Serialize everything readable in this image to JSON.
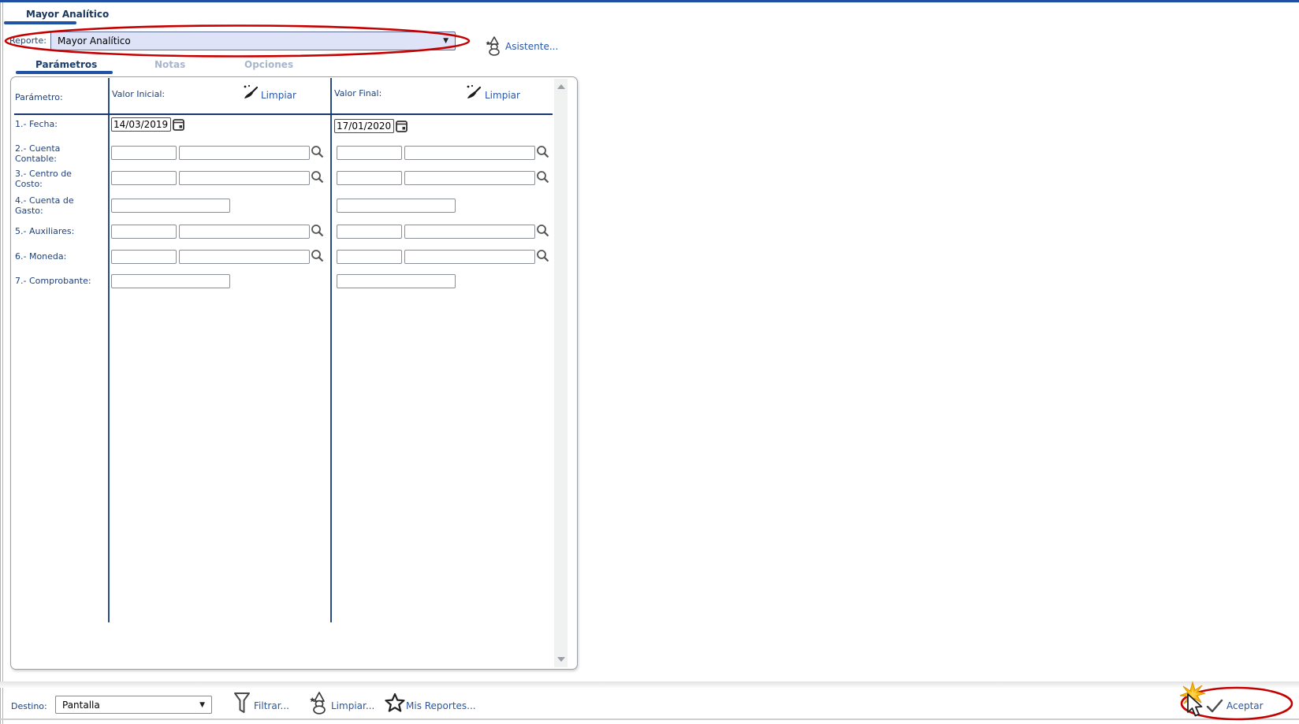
{
  "window": {
    "page_tab": "Mayor Analítico"
  },
  "report_bar": {
    "label": "Reporte:",
    "selected": "Mayor Analítico",
    "dropdown_caret": "▼",
    "assistant": "Asistente..."
  },
  "tabs": {
    "parameters": "Parámetros",
    "notes": "Notas",
    "options": "Opciones"
  },
  "grid": {
    "param_header": "Parámetro:",
    "initial_header": "Valor Inicial:",
    "final_header": "Valor Final:",
    "clear_initial": "Limpiar",
    "clear_final": "Limpiar",
    "rows": [
      {
        "label": "1.- Fecha:",
        "type": "date",
        "initial": "14/03/2019",
        "final": "17/01/2020"
      },
      {
        "label": "2.- Cuenta Contable:",
        "type": "lookup",
        "initial_code": "",
        "initial_desc": "",
        "final_code": "",
        "final_desc": ""
      },
      {
        "label": "3.- Centro de Costo:",
        "type": "lookup",
        "initial_code": "",
        "initial_desc": "",
        "final_code": "",
        "final_desc": ""
      },
      {
        "label": "4.- Cuenta de Gasto:",
        "type": "text",
        "initial": "",
        "final": ""
      },
      {
        "label": "5.- Auxiliares:",
        "type": "lookup",
        "initial_code": "",
        "initial_desc": "",
        "final_code": "",
        "final_desc": ""
      },
      {
        "label": "6.- Moneda:",
        "type": "lookup",
        "initial_code": "",
        "initial_desc": "",
        "final_code": "",
        "final_desc": ""
      },
      {
        "label": "7.- Comprobante:",
        "type": "text",
        "initial": "",
        "final": ""
      }
    ]
  },
  "footer": {
    "destination_label": "Destino:",
    "destination_selected": "Pantalla",
    "dropdown_caret": "▼",
    "filter": "Filtrar...",
    "clear": "Limpiar...",
    "my_reports": "Mis Reportes...",
    "accept": "Aceptar"
  },
  "icons": {
    "wizard": "wizard-icon",
    "broom": "broom-icon",
    "magnifier": "magnifier-icon",
    "calendar": "calendar-icon",
    "funnel": "funnel-icon",
    "star": "star-icon",
    "check": "check-icon",
    "caret": "caret-down-icon",
    "cursor": "mouse-cursor-icon",
    "click_burst": "click-starburst-icon",
    "annotation": "red-ellipse-annotation"
  },
  "colors": {
    "top_line": "#2050a4",
    "accent_underline": "#2153a4",
    "label_navy": "#1f4077",
    "link_blue": "#2a57a5",
    "inactive_tab": "#a7b6cc",
    "table_line": "#2a4a85",
    "header_line": "#17366d",
    "select_bg": "#dee3f7",
    "annotation_red": "#c40000",
    "starburst_yellow": "#f7b80d"
  }
}
